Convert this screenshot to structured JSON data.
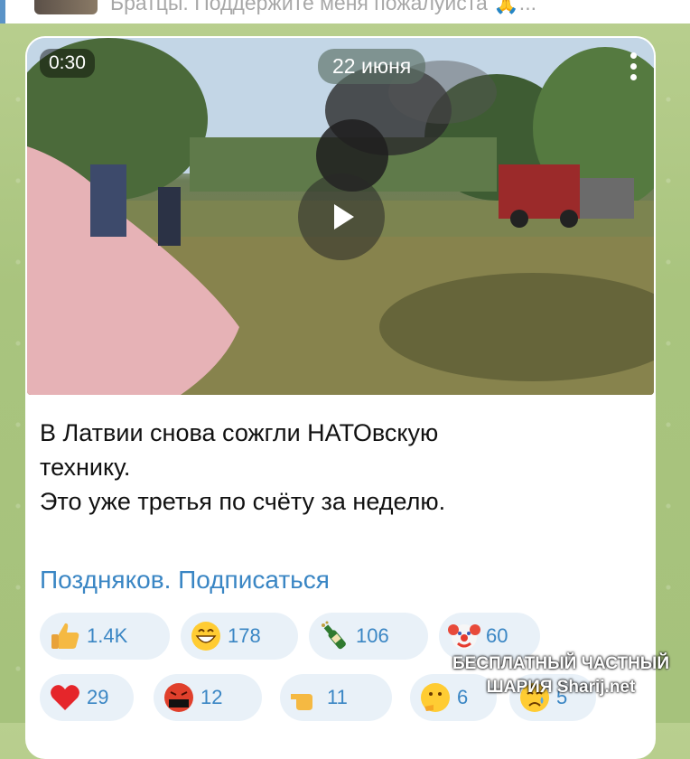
{
  "header": {
    "pinned_text": "Братцы. Поддержите меня пожалуиста 🙏..."
  },
  "video": {
    "duration": "0:30",
    "date": "22 июня"
  },
  "message": {
    "lines": [
      "В Латвии снова сожгли НАТОвскую",
      "технику.",
      "Это уже третья по счёту за неделю."
    ],
    "subscribe_link": "Поздняков. Подписаться"
  },
  "reactions": [
    {
      "icon": "thumbs-up-icon",
      "count": "1.4K"
    },
    {
      "icon": "grinning-face-icon",
      "count": "178"
    },
    {
      "icon": "champagne-bottle-icon",
      "count": "106"
    },
    {
      "icon": "clown-face-icon",
      "count": "60"
    },
    {
      "icon": "red-heart-icon",
      "count": "29"
    },
    {
      "icon": "cursing-face-icon",
      "count": "12"
    },
    {
      "icon": "pointing-hand-icon",
      "count": "11"
    },
    {
      "icon": "thinking-face-icon",
      "count": "6"
    },
    {
      "icon": "crying-face-icon",
      "count": "5"
    }
  ],
  "watermark": {
    "line1": "БЕСПЛАТНЫЙ ЧАСТНЫЙ",
    "line2": "ШАРИЯ Sharij.net"
  },
  "colors": {
    "link": "#3a86c4",
    "reaction_bg": "#e9f1f8",
    "wallpaper": "#a9c47e"
  }
}
